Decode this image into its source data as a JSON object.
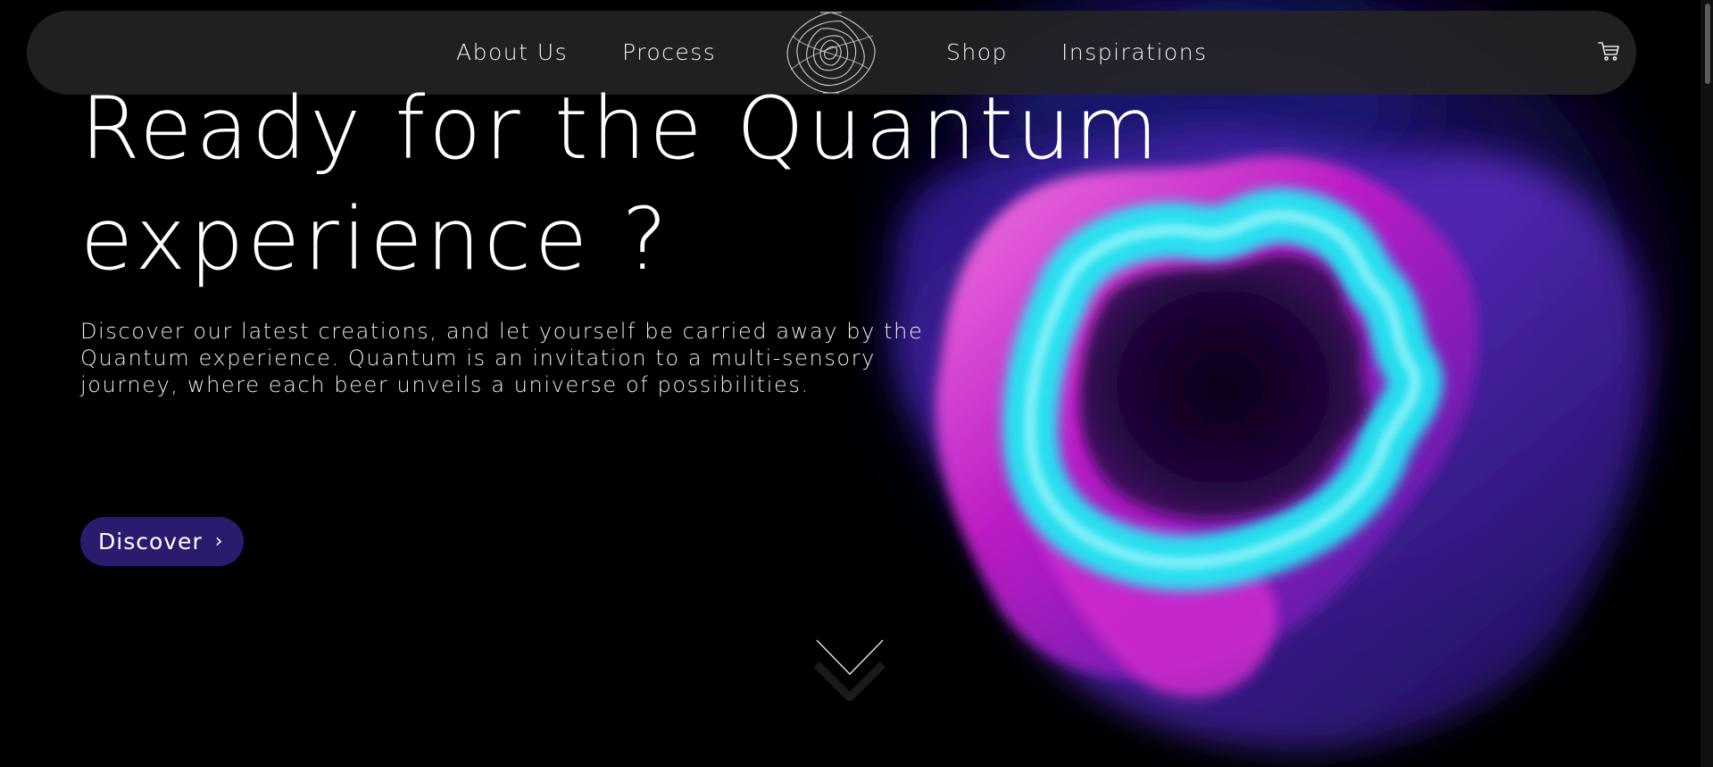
{
  "nav": {
    "links": [
      {
        "label": "About Us"
      },
      {
        "label": "Process"
      },
      {
        "label": "Shop"
      },
      {
        "label": "Inspirations"
      }
    ],
    "logo_icon": "quantum-logo-icon",
    "cart_icon": "cart-icon"
  },
  "hero": {
    "title_line1": "Ready for the Quantum",
    "title_line2": "experience ?",
    "description": "Discover our latest creations, and let yourself be carried away by the Quantum experience. Quantum is an invitation to a multi-sensory journey, where each beer unveils a universe of possibilities.",
    "button_label": "Discover",
    "button_chevron": "›",
    "scroll_icon": "chevron-down-icon"
  },
  "colors": {
    "background": "#000000",
    "navbar": "#242424",
    "button": "#2b1b6e",
    "accent_cyan": "#1ee8f0",
    "accent_magenta": "#d61ec9",
    "accent_purple": "#4a1fb8"
  }
}
